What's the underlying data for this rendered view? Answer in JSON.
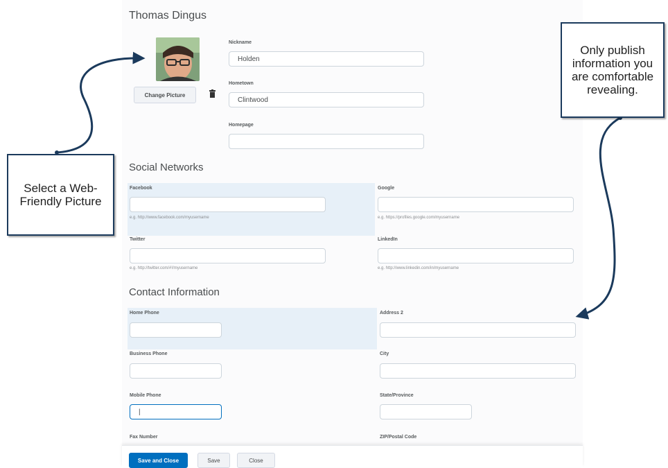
{
  "profile": {
    "name": "Thomas Dingus",
    "change_picture": "Change Picture",
    "nickname_label": "Nickname",
    "nickname": "Holden",
    "hometown_label": "Hometown",
    "hometown": "Clintwood",
    "homepage_label": "Homepage",
    "homepage": ""
  },
  "social": {
    "title": "Social Networks",
    "facebook_label": "Facebook",
    "facebook_hint": "e.g. http://www.facebook.com/myusername",
    "google_label": "Google",
    "google_hint": "e.g. https://profiles.google.com/myusername",
    "twitter_label": "Twitter",
    "twitter_hint": "e.g. http://twitter.com/#!/myusername",
    "linkedin_label": "LinkedIn",
    "linkedin_hint": "e.g. http://www.linkedin.com/in/myusername"
  },
  "contact": {
    "title": "Contact Information",
    "home_phone_label": "Home Phone",
    "address2_label": "Address 2",
    "business_phone_label": "Business Phone",
    "city_label": "City",
    "mobile_phone_label": "Mobile Phone",
    "mobile_phone_value": "|",
    "state_label": "State/Province",
    "fax_label": "Fax Number",
    "zip_label": "ZIP/Postal Code"
  },
  "footer": {
    "save_close": "Save and Close",
    "save": "Save",
    "close": "Close"
  },
  "callouts": {
    "left": "Select a Web-Friendly Picture",
    "right": "Only publish information you are comfortable revealing."
  },
  "colors": {
    "primary": "#006fbf",
    "callout_border": "#1b3a5c",
    "highlight": "#e7f0f8"
  }
}
